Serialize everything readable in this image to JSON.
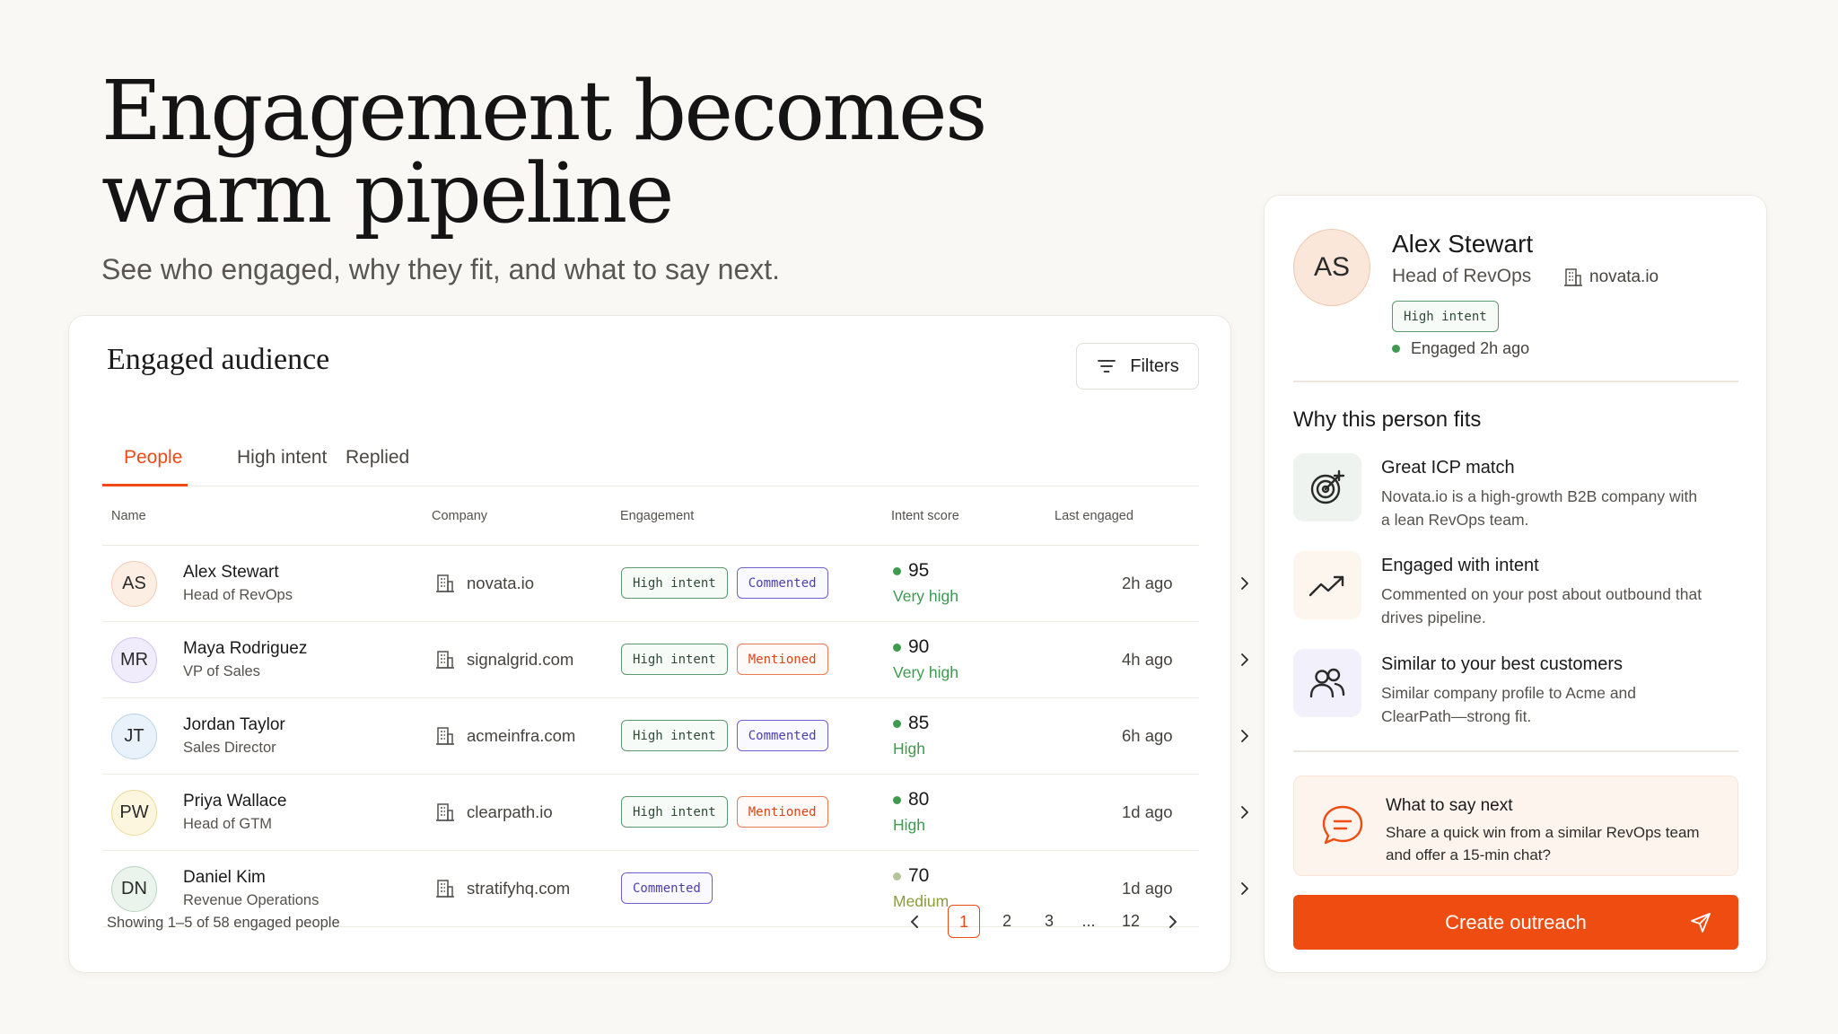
{
  "hero": {
    "title_line1": "Engagement becomes",
    "title_line2": "warm pipeline",
    "subtitle": "See who engaged, why they fit, and what to say next."
  },
  "audience": {
    "title": "Engaged audience",
    "filters_label": "Filters",
    "tabs": [
      {
        "label": "People",
        "active": true
      },
      {
        "label": "High intent",
        "active": false
      },
      {
        "label": "Replied",
        "active": false
      }
    ],
    "columns": [
      "Name",
      "Company",
      "Engagement",
      "Intent score",
      "Last engaged"
    ],
    "rows": [
      {
        "initials": "AS",
        "name": "Alex Stewart",
        "title": "Head of RevOps",
        "company": "novata.io",
        "tags": [
          "High intent",
          "Commented"
        ],
        "score": "95",
        "score_label": "Very high",
        "last": "2h ago"
      },
      {
        "initials": "MR",
        "name": "Maya Rodriguez",
        "title": "VP of Sales",
        "company": "signalgrid.com",
        "tags": [
          "High intent",
          "Mentioned"
        ],
        "score": "90",
        "score_label": "Very high",
        "last": "4h ago"
      },
      {
        "initials": "JT",
        "name": "Jordan Taylor",
        "title": "Sales Director",
        "company": "acmeinfra.com",
        "tags": [
          "High intent",
          "Commented"
        ],
        "score": "85",
        "score_label": "High",
        "last": "6h ago"
      },
      {
        "initials": "PW",
        "name": "Priya Wallace",
        "title": "Head of GTM",
        "company": "clearpath.io",
        "tags": [
          "High intent",
          "Mentioned"
        ],
        "score": "80",
        "score_label": "High",
        "last": "1d ago"
      },
      {
        "initials": "DN",
        "name": "Daniel Kim",
        "title": "Revenue Operations",
        "company": "stratifyhq.com",
        "tags": [
          "Commented"
        ],
        "score": "70",
        "score_label": "Medium",
        "last": "1d ago"
      }
    ],
    "showing": "Showing 1–5 of 58 engaged people",
    "pages": [
      "1",
      "2",
      "3",
      "...",
      "12"
    ],
    "current_page": "1"
  },
  "profile": {
    "initials": "AS",
    "name": "Alex Stewart",
    "role": "Head of RevOps",
    "company": "novata.io",
    "tag": "High intent",
    "engaged": "Engaged 2h ago",
    "why_title": "Why this person fits",
    "fits": [
      {
        "title": "Great ICP match",
        "desc": "Novata.io is a high-growth B2B company with a lean RevOps team."
      },
      {
        "title": "Engaged with intent",
        "desc": "Commented on your post about outbound that drives pipeline."
      },
      {
        "title": "Similar to your best customers",
        "desc": "Similar company profile to Acme and ClearPath—strong fit."
      }
    ],
    "say_title": "What to say next",
    "say_desc": "Share a quick win from a similar RevOps team and offer a 15-min chat?",
    "cta": "Create outreach"
  },
  "colors": {
    "accent": "#ee4a14",
    "high_intent": "#5b9a6e",
    "commented": "#6d61d2",
    "mentioned": "#ec7a52",
    "score_green": "#3d9a4f",
    "score_medium": "#b5c49a"
  }
}
